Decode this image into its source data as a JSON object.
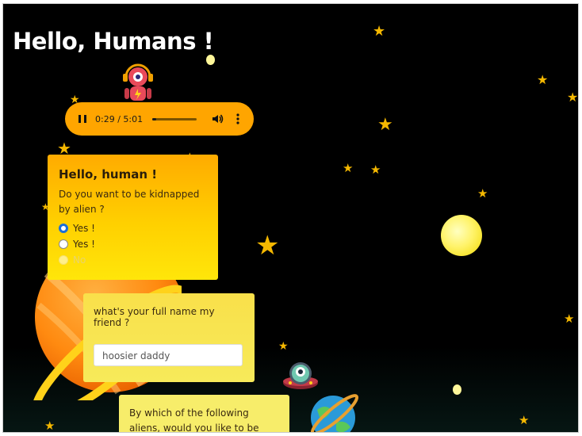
{
  "page": {
    "title": "Hello, Humans !"
  },
  "audio_player": {
    "time": "0:29 / 5:01",
    "progress_fraction": 0.096,
    "play_icon": "pause-icon",
    "volume_icon": "volume-icon",
    "menu_icon": "more-vert-icon"
  },
  "question1": {
    "heading": "Hello, human !",
    "question": "Do you want to be kidnapped by alien ?",
    "options": [
      {
        "label": "Yes !",
        "state": "checked"
      },
      {
        "label": "Yes !",
        "state": "unchecked"
      },
      {
        "label": "No",
        "state": "disabled"
      }
    ]
  },
  "question2": {
    "question": "what's your full name my friend ?",
    "input_value": "hoosier daddy"
  },
  "question3": {
    "question": "By which of the following aliens, would you like to be kidnapped?"
  },
  "colors": {
    "background": "#000000",
    "accent": "#ffa500",
    "star": "#f5b800",
    "radio_checked": "#1a6fd8"
  }
}
